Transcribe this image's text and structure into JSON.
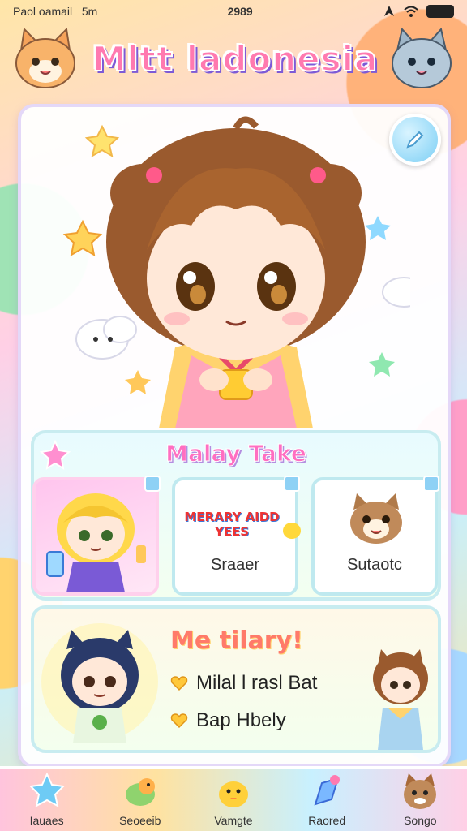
{
  "status_bar": {
    "left_text": "Paol oamail",
    "carrier": "5m",
    "time": "2989"
  },
  "app": {
    "title": "Mltt ladonesia"
  },
  "featured": {
    "title": "Malay Take",
    "cards": [
      {
        "label": ""
      },
      {
        "logo_text": "MERARY AIDD YEES",
        "label": "Sraaer"
      },
      {
        "label": "Sutaotc"
      }
    ]
  },
  "promo": {
    "title": "Me tilary!",
    "items": [
      "Milal l rasl Bat",
      "Bap Hbely"
    ]
  },
  "bottom_nav": {
    "items": [
      {
        "label": "Iauaes",
        "icon": "star-icon"
      },
      {
        "label": "Seoeeib",
        "icon": "chick-icon"
      },
      {
        "label": "Vamgte",
        "icon": "duck-icon"
      },
      {
        "label": "Raored",
        "icon": "gem-icon"
      },
      {
        "label": "Songo",
        "icon": "dog-icon"
      }
    ]
  },
  "colors": {
    "accent_pink": "#ff6fc1",
    "accent_blue": "#7ccff5",
    "card_border": "#c8ecf0"
  }
}
